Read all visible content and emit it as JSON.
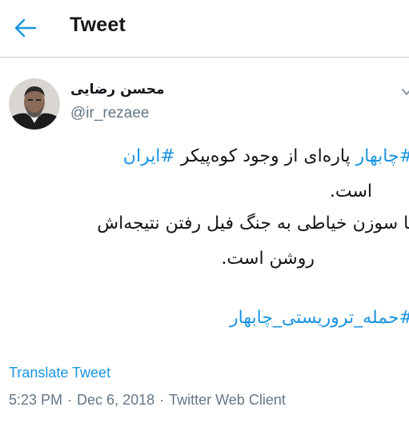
{
  "header": {
    "title": "Tweet",
    "back_icon": "arrow-left-icon",
    "accent": "#1b95e0"
  },
  "author": {
    "name": "محسن رضایی",
    "handle": "@ir_rezaee"
  },
  "tweet": {
    "line1_hashtag_a": "#چابهار",
    "line1_text": " پاره‌ای از وجود کوه‌پیکر ",
    "line1_hashtag_b": "#ایران",
    "line2_text": "است.",
    "line3_text": "با سوزن خیاطی به جنگ فیل رفتن نتیجه‌اش",
    "line4_text": "روشن است.",
    "line5_hashtag": "#حمله_تروریستی_چابهار"
  },
  "actions": {
    "translate_label": "Translate Tweet"
  },
  "meta": {
    "time": "5:23 PM",
    "date": "Dec 6, 2018",
    "separator": "·",
    "client": "Twitter Web Client"
  },
  "colors": {
    "link": "#1b95e0",
    "text": "#14171a",
    "secondary": "#657786",
    "divider": "#c9d1d7"
  }
}
